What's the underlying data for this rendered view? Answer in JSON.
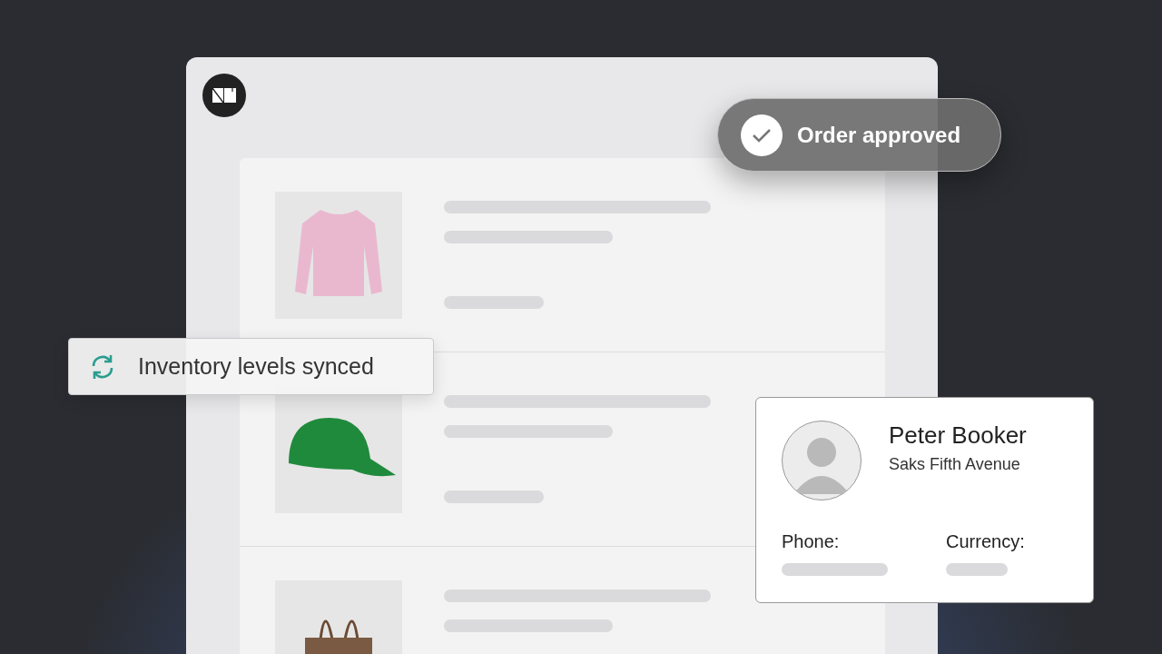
{
  "toast": {
    "text": "Order approved"
  },
  "sync_notice": {
    "text": "Inventory levels synced"
  },
  "products": [
    {
      "kind": "sweater"
    },
    {
      "kind": "cap"
    },
    {
      "kind": "bag"
    }
  ],
  "contact_card": {
    "name": "Peter Booker",
    "company": "Saks Fifth Avenue",
    "fields": [
      {
        "label": "Phone:"
      },
      {
        "label": "Currency:"
      }
    ]
  }
}
